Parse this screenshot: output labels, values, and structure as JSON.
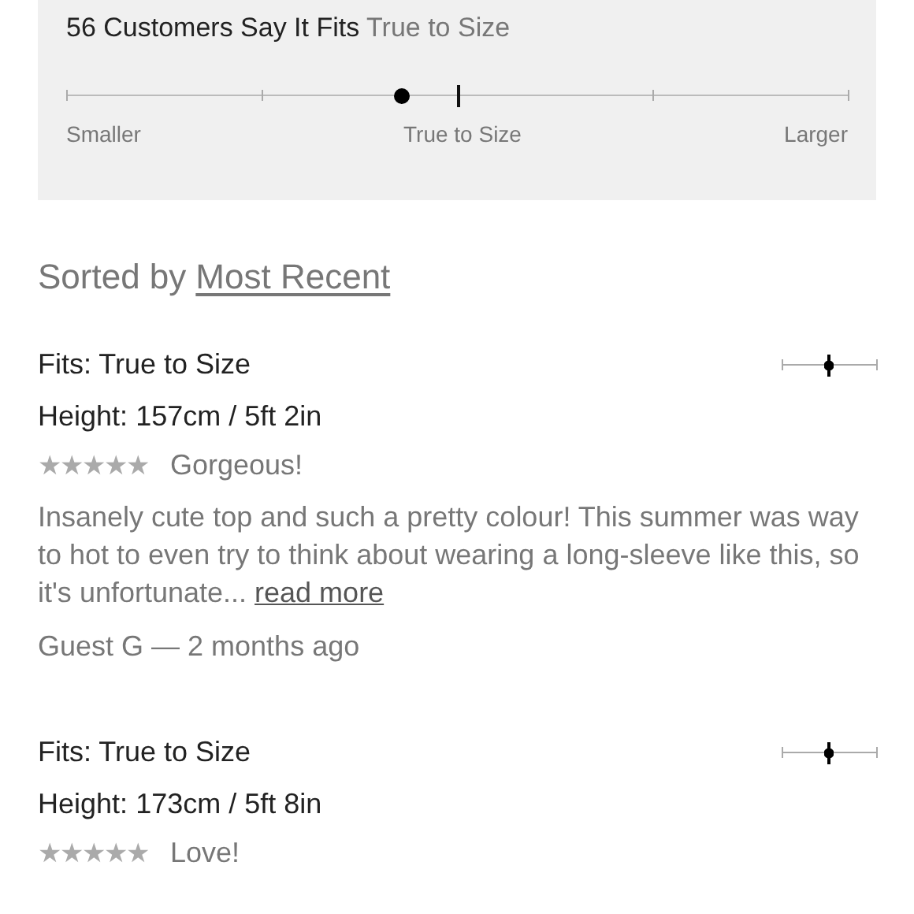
{
  "fit_summary": {
    "count_text": "56 Customers Say It Fits",
    "verdict": "True to Size",
    "level": 0.43,
    "scale_labels": [
      "Smaller",
      "True to Size",
      "Larger"
    ]
  },
  "sort": {
    "label": "Sorted by",
    "value": "Most Recent"
  },
  "reviews": [
    {
      "fit": "Fits: True to Size",
      "level": 0.5,
      "height_label": "Height:",
      "height": "157cm / 5ft 2in",
      "stars": 5,
      "title": "Gorgeous!",
      "body": "Insanely cute top and such a pretty colour! This summer was way to hot to even try to think about wearing a long-sleeve like this, so it's unfortunate...",
      "read_more": "read more",
      "author": "Guest G — 2 months ago"
    },
    {
      "fit": "Fits: True to Size",
      "level": 0.5,
      "height_label": "Height:",
      "height": "173cm / 5ft 8in",
      "stars": 5,
      "title": "Love!"
    }
  ]
}
